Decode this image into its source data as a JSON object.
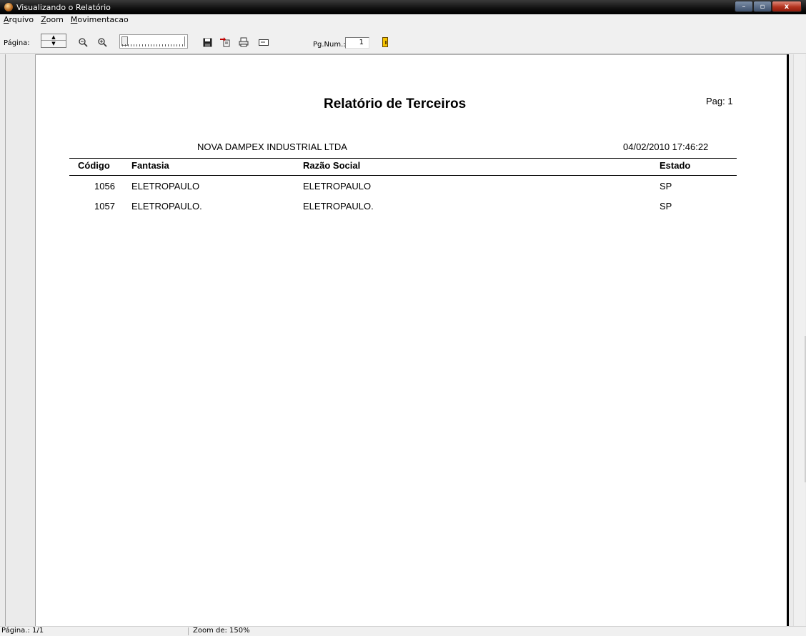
{
  "window": {
    "title": "Visualizando o Relatório",
    "controls": {
      "minimize": "–",
      "maximize": "▫",
      "close": "x"
    }
  },
  "menu": {
    "items": [
      {
        "accel": "A",
        "rest": "rquivo"
      },
      {
        "accel": "Z",
        "rest": "oom"
      },
      {
        "accel": "M",
        "rest": "ovimentacao"
      }
    ]
  },
  "toolbar": {
    "page_label": "Página:",
    "pgnum_label": "Pg.Num.:",
    "pgnum_value": "1",
    "icons": [
      "zoom-out-icon",
      "zoom-in-icon",
      "save-icon",
      "export-icon",
      "print-icon",
      "setup-icon",
      "exit-icon"
    ]
  },
  "report": {
    "title": "Relatório de Terceiros",
    "page": "Pag: 1",
    "company": "NOVA DAMPEX INDUSTRIAL LTDA",
    "datetime": "04/02/2010 17:46:22",
    "columns": {
      "codigo": "Código",
      "fantasia": "Fantasia",
      "razao": "Razão Social",
      "estado": "Estado"
    },
    "rows": [
      {
        "codigo": "1056",
        "fantasia": "ELETROPAULO",
        "razao": "ELETROPAULO",
        "estado": "SP"
      },
      {
        "codigo": "1057",
        "fantasia": "ELETROPAULO.",
        "razao": "ELETROPAULO.",
        "estado": "SP"
      }
    ]
  },
  "status": {
    "page": "Página.: 1/1",
    "zoom": "Zoom de: 150%"
  }
}
